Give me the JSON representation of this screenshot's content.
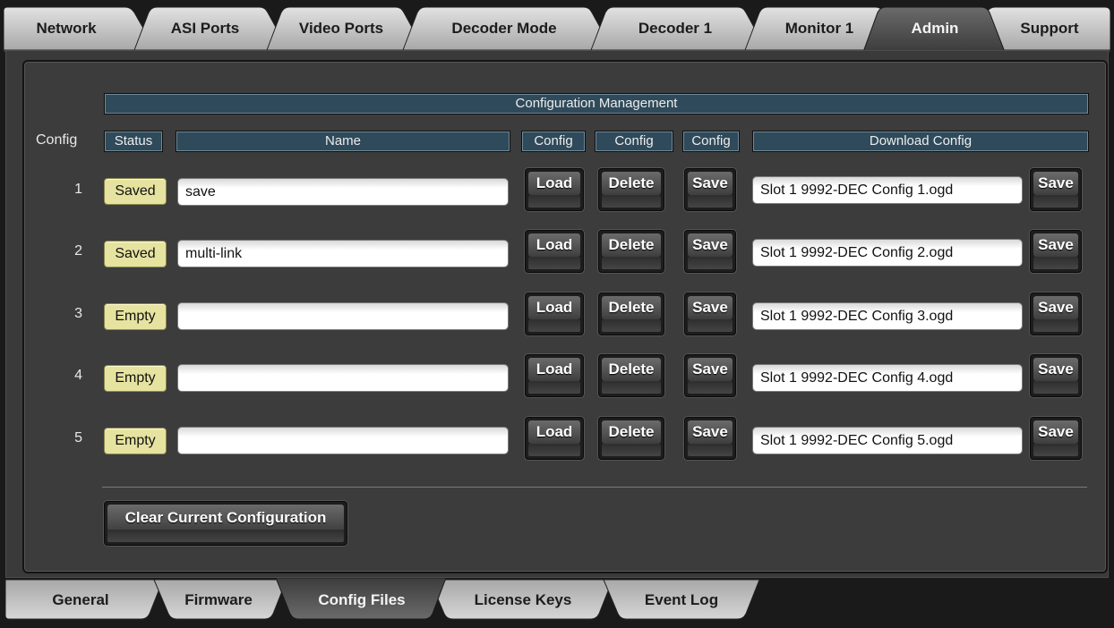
{
  "top_tabs": [
    "Network",
    "ASI Ports",
    "Video Ports",
    "Decoder Mode",
    "Decoder 1",
    "Monitor 1",
    "Admin",
    "Support"
  ],
  "active_top_tab": "Admin",
  "bottom_tabs": [
    "General",
    "Firmware",
    "Config Files",
    "License Keys",
    "Event Log"
  ],
  "active_bottom_tab": "Config Files",
  "config": {
    "title": "Configuration Management",
    "row_label": "Config",
    "headers": {
      "status": "Status",
      "name": "Name",
      "load": "Config",
      "delete": "Config",
      "save": "Config",
      "download": "Download Config"
    },
    "rows": [
      {
        "num": "1",
        "status": "Saved",
        "name": "save",
        "load": "Load",
        "delete": "Delete",
        "save": "Save",
        "download_file": "Slot 1 9992-DEC Config 1.ogd",
        "download_save": "Save"
      },
      {
        "num": "2",
        "status": "Saved",
        "name": "multi-link",
        "load": "Load",
        "delete": "Delete",
        "save": "Save",
        "download_file": "Slot 1 9992-DEC Config 2.ogd",
        "download_save": "Save"
      },
      {
        "num": "3",
        "status": "Empty",
        "name": "",
        "load": "Load",
        "delete": "Delete",
        "save": "Save",
        "download_file": "Slot 1 9992-DEC Config 3.ogd",
        "download_save": "Save"
      },
      {
        "num": "4",
        "status": "Empty",
        "name": "",
        "load": "Load",
        "delete": "Delete",
        "save": "Save",
        "download_file": "Slot 1 9992-DEC Config 4.ogd",
        "download_save": "Save"
      },
      {
        "num": "5",
        "status": "Empty",
        "name": "",
        "load": "Load",
        "delete": "Delete",
        "save": "Save",
        "download_file": "Slot 1 9992-DEC Config 5.ogd",
        "download_save": "Save"
      }
    ],
    "clear_button": "Clear Current Configuration"
  },
  "colors": {
    "header_bg": "#2f4a5a",
    "status_bg": "#e6e3a0",
    "tab_inactive": "#c4c4c4",
    "tab_active": "#4a4a4a"
  }
}
